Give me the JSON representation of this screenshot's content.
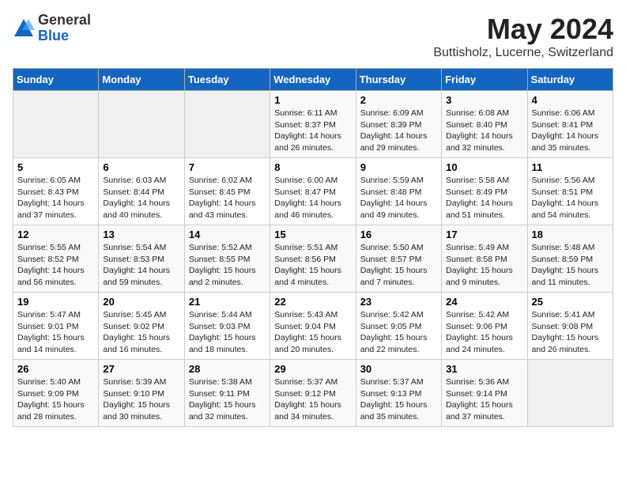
{
  "logo": {
    "general": "General",
    "blue": "Blue"
  },
  "title": {
    "month_year": "May 2024",
    "location": "Buttisholz, Lucerne, Switzerland"
  },
  "headers": [
    "Sunday",
    "Monday",
    "Tuesday",
    "Wednesday",
    "Thursday",
    "Friday",
    "Saturday"
  ],
  "weeks": [
    [
      {
        "day": "",
        "info": ""
      },
      {
        "day": "",
        "info": ""
      },
      {
        "day": "",
        "info": ""
      },
      {
        "day": "1",
        "info": "Sunrise: 6:11 AM\nSunset: 8:37 PM\nDaylight: 14 hours\nand 26 minutes."
      },
      {
        "day": "2",
        "info": "Sunrise: 6:09 AM\nSunset: 8:39 PM\nDaylight: 14 hours\nand 29 minutes."
      },
      {
        "day": "3",
        "info": "Sunrise: 6:08 AM\nSunset: 8:40 PM\nDaylight: 14 hours\nand 32 minutes."
      },
      {
        "day": "4",
        "info": "Sunrise: 6:06 AM\nSunset: 8:41 PM\nDaylight: 14 hours\nand 35 minutes."
      }
    ],
    [
      {
        "day": "5",
        "info": "Sunrise: 6:05 AM\nSunset: 8:43 PM\nDaylight: 14 hours\nand 37 minutes."
      },
      {
        "day": "6",
        "info": "Sunrise: 6:03 AM\nSunset: 8:44 PM\nDaylight: 14 hours\nand 40 minutes."
      },
      {
        "day": "7",
        "info": "Sunrise: 6:02 AM\nSunset: 8:45 PM\nDaylight: 14 hours\nand 43 minutes."
      },
      {
        "day": "8",
        "info": "Sunrise: 6:00 AM\nSunset: 8:47 PM\nDaylight: 14 hours\nand 46 minutes."
      },
      {
        "day": "9",
        "info": "Sunrise: 5:59 AM\nSunset: 8:48 PM\nDaylight: 14 hours\nand 49 minutes."
      },
      {
        "day": "10",
        "info": "Sunrise: 5:58 AM\nSunset: 8:49 PM\nDaylight: 14 hours\nand 51 minutes."
      },
      {
        "day": "11",
        "info": "Sunrise: 5:56 AM\nSunset: 8:51 PM\nDaylight: 14 hours\nand 54 minutes."
      }
    ],
    [
      {
        "day": "12",
        "info": "Sunrise: 5:55 AM\nSunset: 8:52 PM\nDaylight: 14 hours\nand 56 minutes."
      },
      {
        "day": "13",
        "info": "Sunrise: 5:54 AM\nSunset: 8:53 PM\nDaylight: 14 hours\nand 59 minutes."
      },
      {
        "day": "14",
        "info": "Sunrise: 5:52 AM\nSunset: 8:55 PM\nDaylight: 15 hours\nand 2 minutes."
      },
      {
        "day": "15",
        "info": "Sunrise: 5:51 AM\nSunset: 8:56 PM\nDaylight: 15 hours\nand 4 minutes."
      },
      {
        "day": "16",
        "info": "Sunrise: 5:50 AM\nSunset: 8:57 PM\nDaylight: 15 hours\nand 7 minutes."
      },
      {
        "day": "17",
        "info": "Sunrise: 5:49 AM\nSunset: 8:58 PM\nDaylight: 15 hours\nand 9 minutes."
      },
      {
        "day": "18",
        "info": "Sunrise: 5:48 AM\nSunset: 8:59 PM\nDaylight: 15 hours\nand 11 minutes."
      }
    ],
    [
      {
        "day": "19",
        "info": "Sunrise: 5:47 AM\nSunset: 9:01 PM\nDaylight: 15 hours\nand 14 minutes."
      },
      {
        "day": "20",
        "info": "Sunrise: 5:45 AM\nSunset: 9:02 PM\nDaylight: 15 hours\nand 16 minutes."
      },
      {
        "day": "21",
        "info": "Sunrise: 5:44 AM\nSunset: 9:03 PM\nDaylight: 15 hours\nand 18 minutes."
      },
      {
        "day": "22",
        "info": "Sunrise: 5:43 AM\nSunset: 9:04 PM\nDaylight: 15 hours\nand 20 minutes."
      },
      {
        "day": "23",
        "info": "Sunrise: 5:42 AM\nSunset: 9:05 PM\nDaylight: 15 hours\nand 22 minutes."
      },
      {
        "day": "24",
        "info": "Sunrise: 5:42 AM\nSunset: 9:06 PM\nDaylight: 15 hours\nand 24 minutes."
      },
      {
        "day": "25",
        "info": "Sunrise: 5:41 AM\nSunset: 9:08 PM\nDaylight: 15 hours\nand 26 minutes."
      }
    ],
    [
      {
        "day": "26",
        "info": "Sunrise: 5:40 AM\nSunset: 9:09 PM\nDaylight: 15 hours\nand 28 minutes."
      },
      {
        "day": "27",
        "info": "Sunrise: 5:39 AM\nSunset: 9:10 PM\nDaylight: 15 hours\nand 30 minutes."
      },
      {
        "day": "28",
        "info": "Sunrise: 5:38 AM\nSunset: 9:11 PM\nDaylight: 15 hours\nand 32 minutes."
      },
      {
        "day": "29",
        "info": "Sunrise: 5:37 AM\nSunset: 9:12 PM\nDaylight: 15 hours\nand 34 minutes."
      },
      {
        "day": "30",
        "info": "Sunrise: 5:37 AM\nSunset: 9:13 PM\nDaylight: 15 hours\nand 35 minutes."
      },
      {
        "day": "31",
        "info": "Sunrise: 5:36 AM\nSunset: 9:14 PM\nDaylight: 15 hours\nand 37 minutes."
      },
      {
        "day": "",
        "info": ""
      }
    ]
  ]
}
